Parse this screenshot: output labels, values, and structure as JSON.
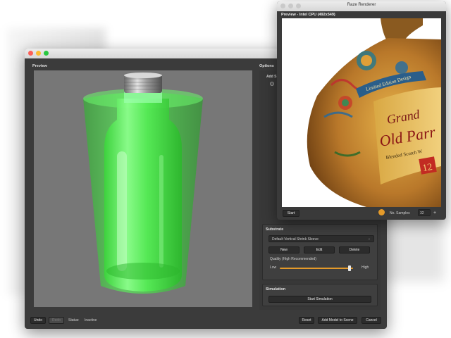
{
  "main_window": {
    "preview_label": "Preview",
    "options_label": "Options",
    "add_label": "Add S",
    "substrate": {
      "title": "Substrate",
      "selected": "Default Vertical Shrink Sleeve",
      "new_label": "New",
      "edit_label": "Edit",
      "delete_label": "Delete",
      "quality_label": "Quality (High Recommended)",
      "low_label": "Low",
      "high_label": "High",
      "quality_value": 0.95
    },
    "simulation": {
      "title": "Simulation",
      "start_label": "Start Simulation"
    },
    "bottom_bar": {
      "undo_label": "Undo",
      "redo_label": "Redo",
      "status_label": "Status:",
      "status_value": "Inactive",
      "reset_label": "Reset",
      "add_model_label": "Add Model to Scene",
      "cancel_label": "Cancel"
    }
  },
  "renderer_window": {
    "title": "Raze Renderer",
    "header": "Preview - Intel CPU (492x549)",
    "start_label": "Start",
    "samples_label": "No. Samples",
    "samples_value": "32",
    "plus_label": "+",
    "bottle_label_text": "Limited Edition Design",
    "brand_line1": "Grand",
    "brand_line2": "Old Parr",
    "brand_sub": "Blended Scotch W",
    "age": "12"
  },
  "colors": {
    "accent_orange": "#e49a2a",
    "sleeve_green": "#33e233",
    "window_bg": "#3b3b3b"
  }
}
